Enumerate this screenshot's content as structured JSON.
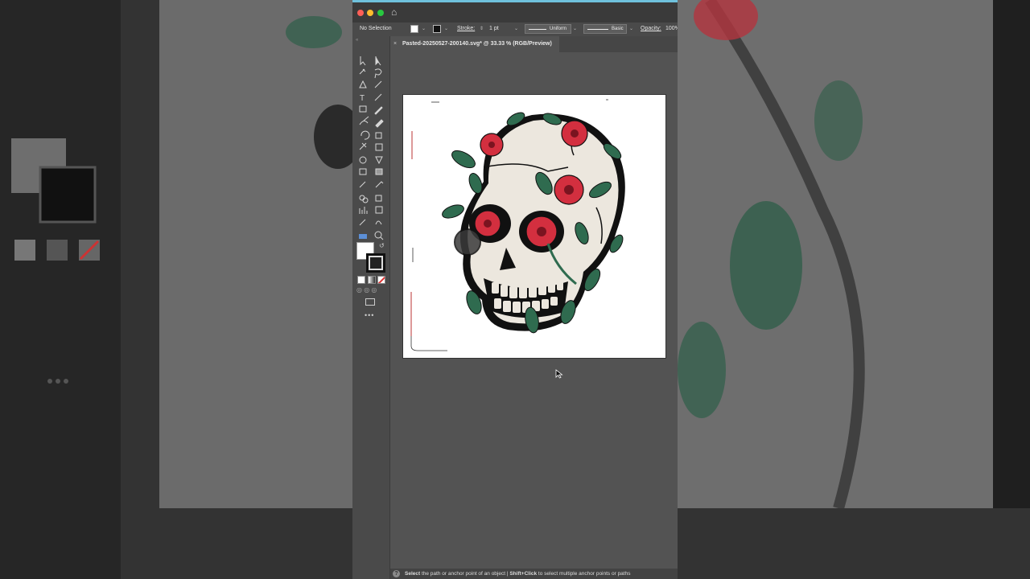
{
  "window": {
    "traffic_lights": {
      "close": "#ff5f57",
      "minimize": "#febc2e",
      "zoom": "#28c840"
    },
    "accent": "#6fc1dc"
  },
  "control_bar": {
    "selection": "No Selection",
    "stroke_label": "Stroke:",
    "stroke_weight": "1 pt",
    "profile": "Uniform",
    "brush": "Basic",
    "opacity_label": "Opacity:",
    "opacity_value": "100%"
  },
  "document_tab": {
    "close": "×",
    "title": "Pasted-20250527-200140.svg* @ 33.33 % (RGB/Preview)"
  },
  "toolbar": {
    "tools": [
      "selection-tool",
      "direct-selection-tool",
      "magic-wand-tool",
      "lasso-tool",
      "pen-tool",
      "brush-tool",
      "type-tool",
      "line-tool",
      "rectangle-tool",
      "paintbrush-tool",
      "shaper-tool",
      "eraser-tool",
      "rotate-tool",
      "scale-tool",
      "warp-tool",
      "free-transform-tool",
      "shape-builder-tool",
      "perspective-tool",
      "mesh-tool",
      "gradient-tool",
      "eyedropper-tool",
      "blend-tool",
      "symbol-sprayer-tool",
      "artboard-tool",
      "graph-tool",
      "slice-tool",
      "hand-tool",
      "zoom-tool"
    ],
    "more": "•••"
  },
  "status_bar": {
    "help": "?",
    "message_bold_1": "Select",
    "message_1": " the path or anchor point of an object  |  ",
    "message_bold_2": "Shift+Click",
    "message_2": " to select multiple anchor points or paths"
  },
  "artwork": {
    "subject": "skull-with-roses",
    "colors": {
      "rose": "#d32f3f",
      "leaf": "#2f6b4f",
      "bone": "#ece7de",
      "outline": "#111111"
    }
  }
}
